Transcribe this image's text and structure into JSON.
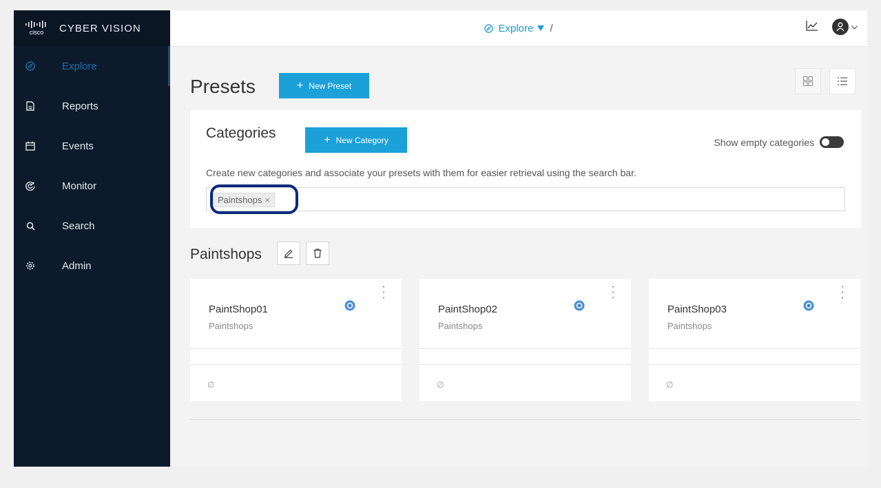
{
  "brand": {
    "logo_text": "cisco",
    "product_name": "CYBER VISION"
  },
  "sidebar": {
    "items": [
      {
        "label": "Explore",
        "icon": "compass-icon",
        "active": true
      },
      {
        "label": "Reports",
        "icon": "document-icon",
        "active": false
      },
      {
        "label": "Events",
        "icon": "calendar-icon",
        "active": false
      },
      {
        "label": "Monitor",
        "icon": "radar-icon",
        "active": false
      },
      {
        "label": "Search",
        "icon": "search-icon",
        "active": false
      },
      {
        "label": "Admin",
        "icon": "gear-icon",
        "active": false
      }
    ]
  },
  "topbar": {
    "crumb_label": "Explore",
    "crumb_sep": "/",
    "icons": [
      "chart-icon",
      "user-avatar-icon",
      "chevron-down-icon"
    ]
  },
  "page": {
    "title": "Presets",
    "new_preset_label": "New Preset"
  },
  "categories": {
    "title": "Categories",
    "new_category_label": "New Category",
    "show_empty_label": "Show empty categories",
    "show_empty_enabled": false,
    "description": "Create new categories and associate your presets with them for easier retrieval using the search bar.",
    "tags": [
      "Paintshops"
    ]
  },
  "group": {
    "title": "Paintshops",
    "cards": [
      {
        "name": "PaintShop01",
        "category": "Paintshops",
        "empty": "∅"
      },
      {
        "name": "PaintShop02",
        "category": "Paintshops",
        "empty": "∅"
      },
      {
        "name": "PaintShop03",
        "category": "Paintshops",
        "empty": "∅"
      }
    ]
  },
  "colors": {
    "accent": "#1ba0d7",
    "sidebar_bg": "#0c1a2b",
    "highlight_ring": "#0a2a7c"
  }
}
